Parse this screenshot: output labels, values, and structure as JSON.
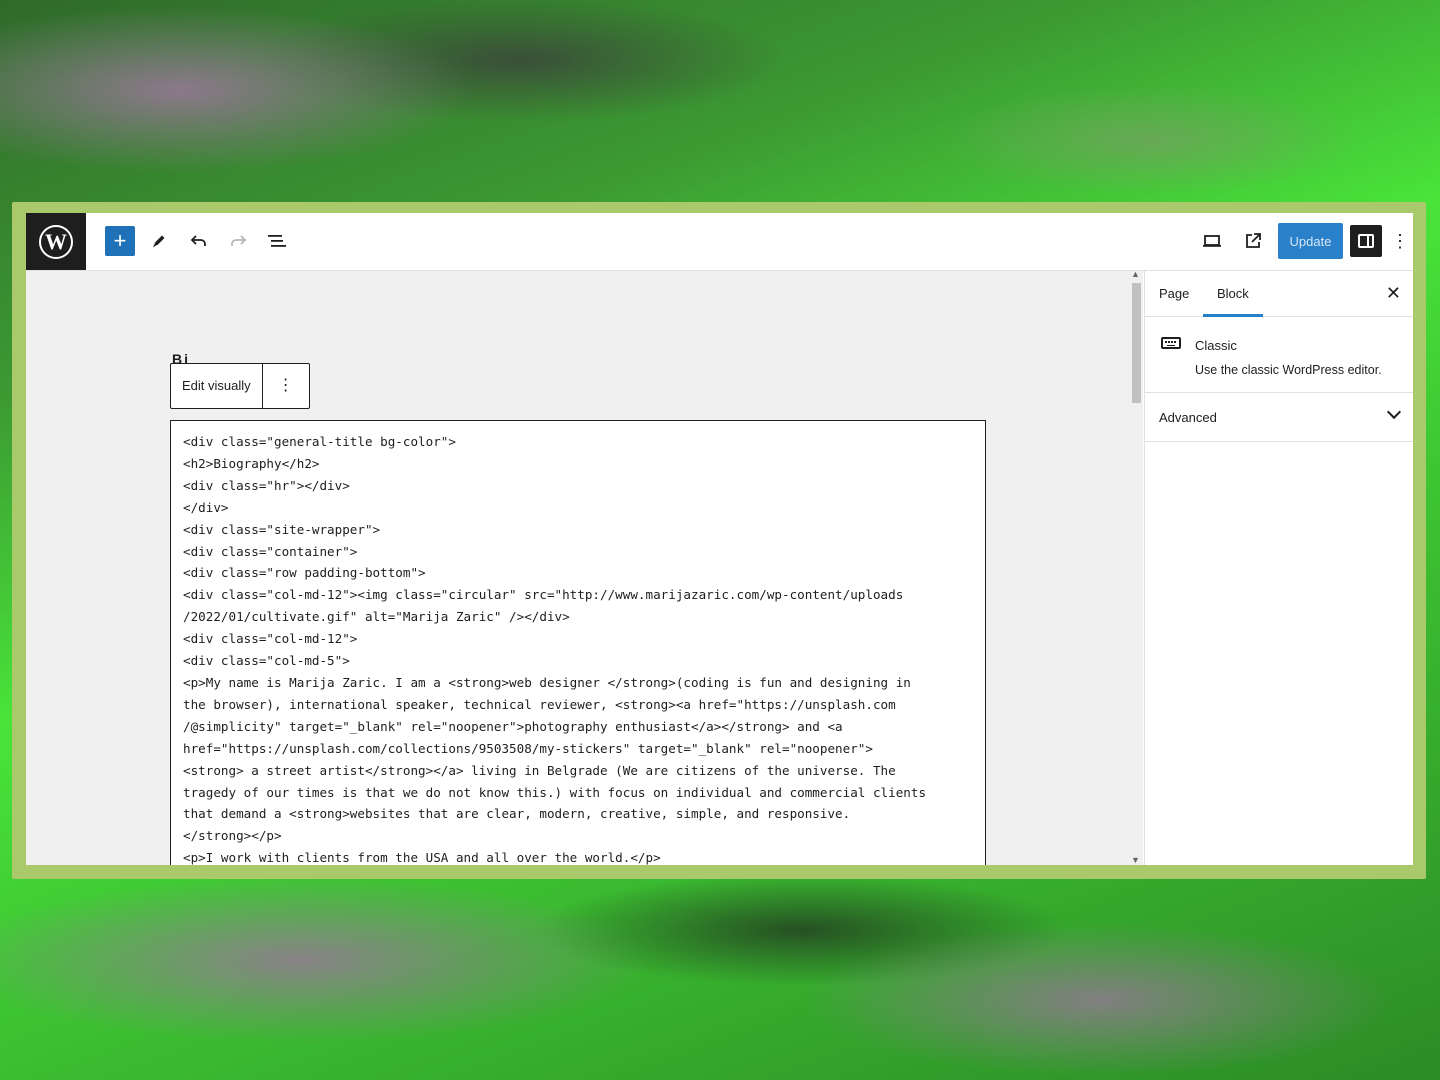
{
  "toolbar": {
    "logo_letter": "W",
    "add_symbol": "+",
    "update_label": "Update",
    "more_symbol": "⋮"
  },
  "canvas": {
    "title_fragment": "Bi",
    "edit_visually_label": "Edit visually",
    "block_more_symbol": "⋮",
    "code_lines": [
      "<div class=\"general-title bg-color\">",
      "<h2>Biography</h2>",
      "<div class=\"hr\"></div>",
      "</div>",
      "<div class=\"site-wrapper\">",
      "<div class=\"container\">",
      "<div class=\"row padding-bottom\">",
      "<div class=\"col-md-12\"><img class=\"circular\" src=\"http://www.marijazaric.com/wp-content/uploads",
      "/2022/01/cultivate.gif\" alt=\"Marija Zaric\" /></div>",
      "<div class=\"col-md-12\">",
      "<div class=\"col-md-5\">",
      "<p>My name is Marija Zaric. I am a <strong>web designer </strong>(coding is fun and designing in",
      "the browser), international speaker, technical reviewer, <strong><a href=\"https://unsplash.com",
      "/@simplicity\" target=\"_blank\" rel=\"noopener\">photography enthusiast</a></strong> and <a",
      "href=\"https://unsplash.com/collections/9503508/my-stickers\" target=\"_blank\" rel=\"noopener\">",
      "<strong> a street artist</strong></a> living in Belgrade (We are citizens of the universe. The",
      "tragedy of our times is that we do not know this.) with focus on individual and commercial clients",
      "that demand a <strong>websites that are clear, modern, creative, simple, and responsive.",
      "</strong></p>",
      "<p>I work with clients from the USA and all over the world.</p>"
    ]
  },
  "sidebar": {
    "tab_page": "Page",
    "tab_block": "Block",
    "close_symbol": "✕",
    "block_name": "Classic",
    "block_description": "Use the classic WordPress editor.",
    "advanced_label": "Advanced"
  },
  "colors": {
    "accent": "#2a80c9",
    "dark": "#1e1e1e",
    "frame": "#a9c96a"
  }
}
